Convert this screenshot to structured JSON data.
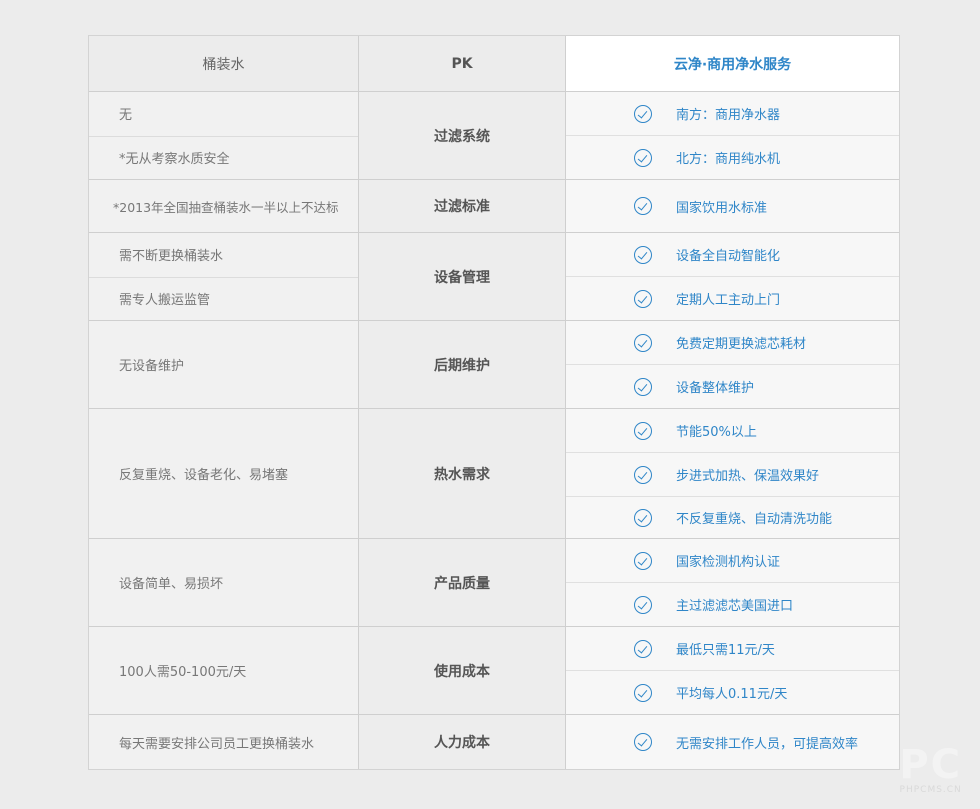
{
  "header": {
    "left": "桶装水",
    "mid": "PK",
    "right": "云净·商用净水服务"
  },
  "groups": [
    {
      "label": "过滤系统",
      "left": [
        "无",
        "*无从考察水质安全"
      ],
      "right": [
        "南方：商用净水器",
        "北方：商用纯水机"
      ]
    },
    {
      "label": "过滤标准",
      "left": [
        "*2013年全国抽查桶装水一半以上不达标"
      ],
      "right": [
        "国家饮用水标准"
      ]
    },
    {
      "label": "设备管理",
      "left": [
        "需不断更换桶装水",
        "需专人搬运监管"
      ],
      "right": [
        "设备全自动智能化",
        "定期人工主动上门"
      ]
    },
    {
      "label": "后期维护",
      "left": [
        "无设备维护"
      ],
      "right": [
        "免费定期更换滤芯耗材",
        "设备整体维护"
      ]
    },
    {
      "label": "热水需求",
      "left": [
        "反复重烧、设备老化、易堵塞"
      ],
      "right": [
        "节能50%以上",
        "步进式加热、保温效果好",
        "不反复重烧、自动清洗功能"
      ]
    },
    {
      "label": "产品质量",
      "left": [
        "设备简单、易损坏"
      ],
      "right": [
        "国家检测机构认证",
        "主过滤滤芯美国进口"
      ]
    },
    {
      "label": "使用成本",
      "left": [
        "100人需50-100元/天"
      ],
      "right": [
        "最低只需11元/天",
        "平均每人0.11元/天"
      ]
    },
    {
      "label": "人力成本",
      "left": [
        "每天需要安排公司员工更换桶装水"
      ],
      "right": [
        "无需安排工作人员，可提高效率"
      ]
    }
  ],
  "watermark": {
    "logo": "PC",
    "site": "PHPCMS.CN"
  },
  "colors": {
    "accent": "#2f86c8",
    "background": "#ececec"
  },
  "icons": {
    "check": "check-circle-icon"
  }
}
